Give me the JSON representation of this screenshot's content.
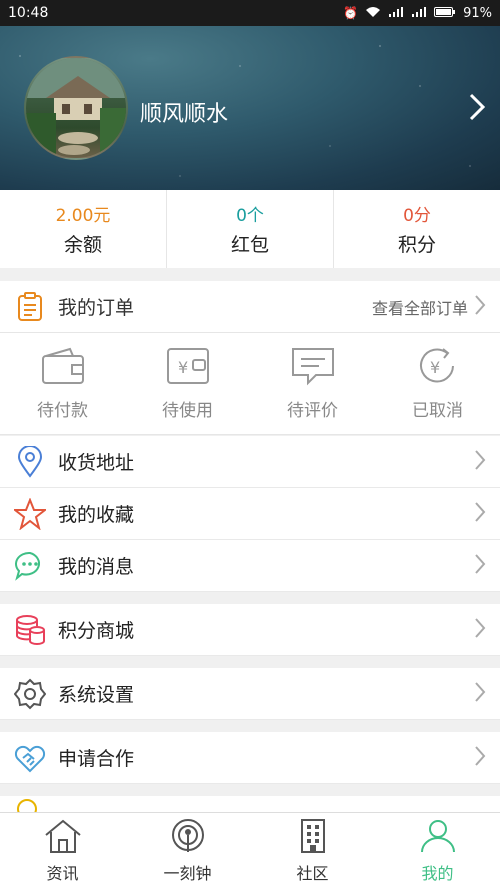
{
  "status_bar": {
    "time": "10:48",
    "battery": "91%"
  },
  "profile": {
    "username": "顺风顺水"
  },
  "stats": [
    {
      "value": "2.00元",
      "label": "余额",
      "color": "#e8891e"
    },
    {
      "value": "0个",
      "label": "红包",
      "color": "#1a9e9e"
    },
    {
      "value": "0分",
      "label": "积分",
      "color": "#e2563a"
    }
  ],
  "orders": {
    "title": "我的订单",
    "view_all": "查看全部订单",
    "items": [
      {
        "label": "待付款",
        "icon": "wallet-icon"
      },
      {
        "label": "待使用",
        "icon": "voucher-icon"
      },
      {
        "label": "待评价",
        "icon": "comment-icon"
      },
      {
        "label": "已取消",
        "icon": "refund-icon"
      }
    ]
  },
  "menu": [
    {
      "label": "收货地址",
      "icon": "location-icon",
      "color": "#4a7fd6"
    },
    {
      "label": "我的收藏",
      "icon": "star-icon",
      "color": "#e2563a"
    },
    {
      "label": "我的消息",
      "icon": "message-icon",
      "color": "#3fbf86"
    },
    {
      "label": "积分商城",
      "icon": "coins-icon",
      "color": "#e8405a"
    },
    {
      "label": "系统设置",
      "icon": "gear-icon",
      "color": "#555555"
    },
    {
      "label": "申请合作",
      "icon": "handshake-icon",
      "color": "#4a9fd6"
    }
  ],
  "tabs": [
    {
      "label": "资讯",
      "icon": "home-icon"
    },
    {
      "label": "一刻钟",
      "icon": "broadcast-icon"
    },
    {
      "label": "社区",
      "icon": "building-icon"
    },
    {
      "label": "我的",
      "icon": "person-icon",
      "active": true
    }
  ],
  "colors": {
    "accent": "#3fbf86",
    "status_bar": "#1b1b1b"
  }
}
